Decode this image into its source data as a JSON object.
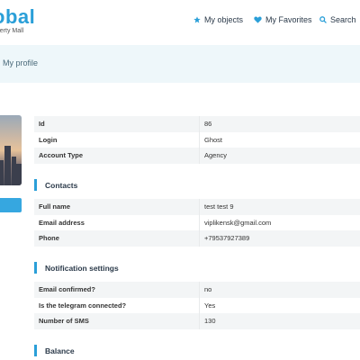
{
  "brand": {
    "name": "obal",
    "tagline": "operty Mall"
  },
  "nav": {
    "objects": "My objects",
    "favorites": "My Favorites",
    "search": "Search"
  },
  "breadcrumb": "My profile",
  "colors": {
    "accent": "#2a9fd8",
    "band": "#eef7fa",
    "button": "#36a7e0"
  },
  "account": [
    {
      "key": "Id",
      "value": "86"
    },
    {
      "key": "Login",
      "value": "Ghost"
    },
    {
      "key": "Account Type",
      "value": "Agency"
    }
  ],
  "contacts": {
    "title": "Contacts",
    "rows": [
      {
        "key": "Full name",
        "value": "test test 9"
      },
      {
        "key": "Email address",
        "value": "viplikensk@gmail.com"
      },
      {
        "key": "Phone",
        "value": "+79537927389"
      }
    ]
  },
  "notifications": {
    "title": "Notification settings",
    "rows": [
      {
        "key": "Email confirmed?",
        "value": "no"
      },
      {
        "key": "Is the telegram connected?",
        "value": "Yes"
      },
      {
        "key": "Number of SMS",
        "value": "130"
      }
    ]
  },
  "balance": {
    "title": "Balance"
  },
  "icons": {
    "objects": "star-icon",
    "favorites": "heart-icon",
    "search": "search-icon"
  }
}
